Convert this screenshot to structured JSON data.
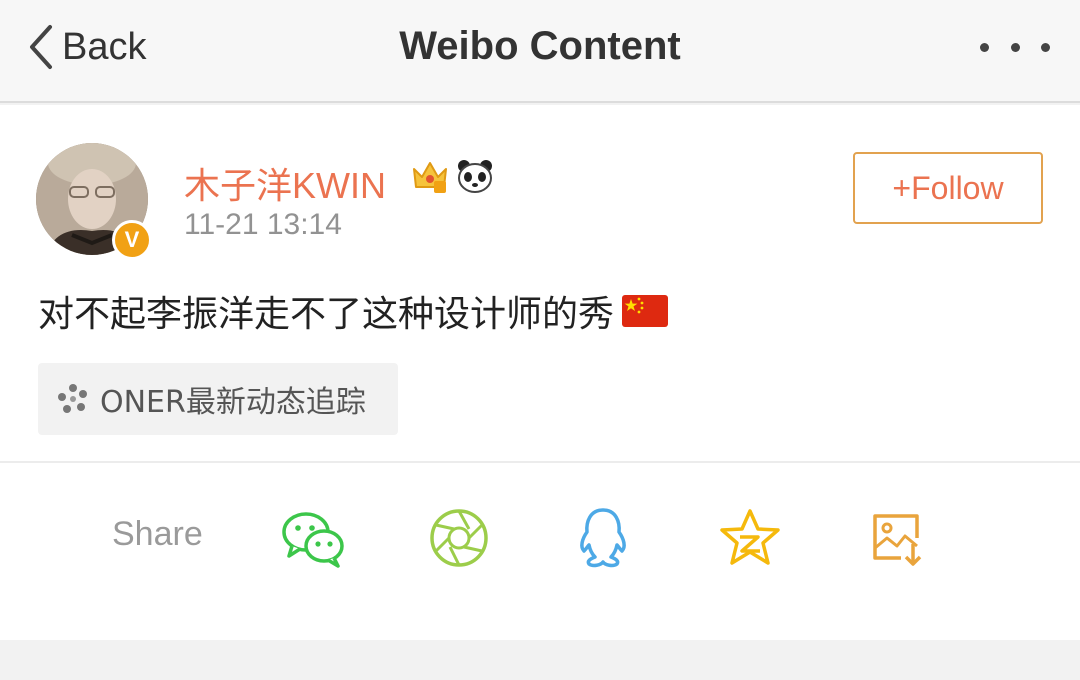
{
  "navbar": {
    "back_label": "Back",
    "title": "Weibo Content",
    "more_icon": "more-icon"
  },
  "post": {
    "username": "木子洋KWIN",
    "timestamp": "11-21 13:14",
    "follow_label": "+Follow",
    "text": "对不起李振洋走不了这种设计师的秀",
    "badges": [
      "crown-icon",
      "panda-icon"
    ],
    "verified_badge": "V",
    "topic": "ONER最新动态追踪"
  },
  "share": {
    "label": "Share",
    "targets": [
      "wechat-icon",
      "moments-icon",
      "qq-icon",
      "qzone-icon",
      "save-image-icon"
    ]
  },
  "colors": {
    "accent": "#eb7350",
    "follow_border": "#e2a24f",
    "wechat": "#3cc64a",
    "moments": "#9ccd4a",
    "qq": "#4da9e6",
    "qzone": "#f5b90c",
    "save": "#e9a43c"
  }
}
